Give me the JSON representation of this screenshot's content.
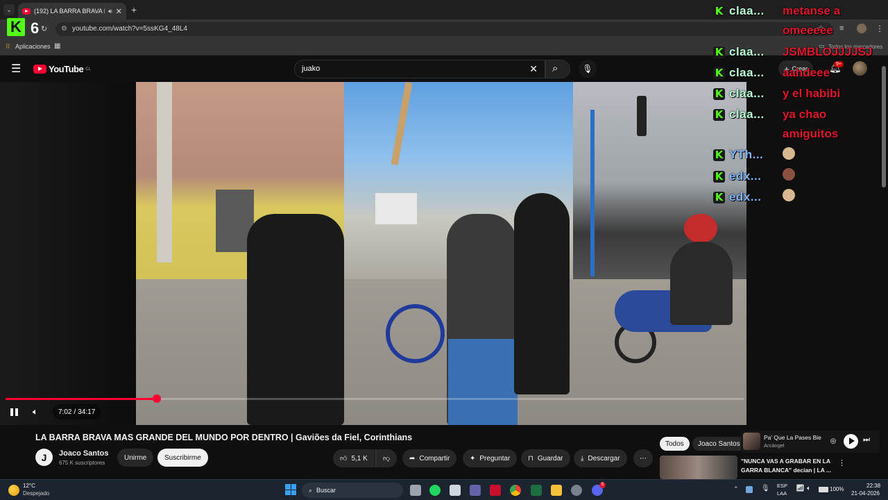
{
  "browser": {
    "tab_title": "(192) LA BARRA BRAVA MA",
    "url": "youtube.com/watch?v=5ssKG4_48L4",
    "bookmarks_apps": "Aplicaciones",
    "bookmarks_all": "Todos los marcadores",
    "overlay_count": "6"
  },
  "youtube": {
    "logo_text": "YouTube",
    "logo_region": "CL",
    "search_value": "juako",
    "create_label": "Crear",
    "notif_badge": "9+"
  },
  "player": {
    "time_current": "7:02",
    "time_separator": "/",
    "time_total": "34:17",
    "progress": 0.2047
  },
  "video": {
    "title": "LA BARRA BRAVA MAS GRANDE DEL MUNDO POR DENTRO | Gaviões da Fiel, Corinthians",
    "channel_name": "Joaco Santos",
    "channel_subs": "675 K suscriptores",
    "avatar_letter": "J",
    "join_label": "Unirme",
    "subscribe_label": "Suscribirme",
    "likes": "5,1 K",
    "share_label": "Compartir",
    "ask_label": "Preguntar",
    "save_label": "Guardar",
    "download_label": "Descargar"
  },
  "sidebar": {
    "chips": [
      "Todos",
      "Joaco Santos"
    ],
    "miniplayer_title": "Pa' Que La Pases Bie",
    "miniplayer_artist": "Arcángel",
    "rec_title_line1": "\"NUNCA VAS A GRABAR EN LA",
    "rec_title_line2": "GARRA BLANCA\" decían | LA ..."
  },
  "chat": {
    "rows": [
      {
        "user": "claa...",
        "color": "green"
      },
      {
        "user": "claa...",
        "color": "green"
      },
      {
        "user": "claa...",
        "color": "green"
      },
      {
        "user": "claa...",
        "color": "green"
      },
      {
        "user": "claa...",
        "color": "green"
      },
      {
        "user": "YTh...",
        "color": "blue"
      },
      {
        "user": "edx...",
        "color": "blue"
      },
      {
        "user": "edx...",
        "color": "blue"
      }
    ],
    "messages": [
      "metanse a",
      "omeeeee",
      "JSMBLOJJJJSJ",
      "aahdeee",
      "y el habibi",
      "ya chao",
      "amiguitos"
    ]
  },
  "taskbar": {
    "weather_temp": "12°C",
    "weather_desc": "Despejado",
    "search_label": "Buscar",
    "lang_line1": "ESP",
    "lang_line2": "LAA",
    "battery": "100%",
    "time": "22:38",
    "date": "21-04-2026",
    "discord_badge": "5"
  },
  "colors": {
    "youtube_red": "#ff0033",
    "kick_green": "#53fc18",
    "chat_red": "#e0162b",
    "subscribe_bg": "#f1f1f1"
  }
}
